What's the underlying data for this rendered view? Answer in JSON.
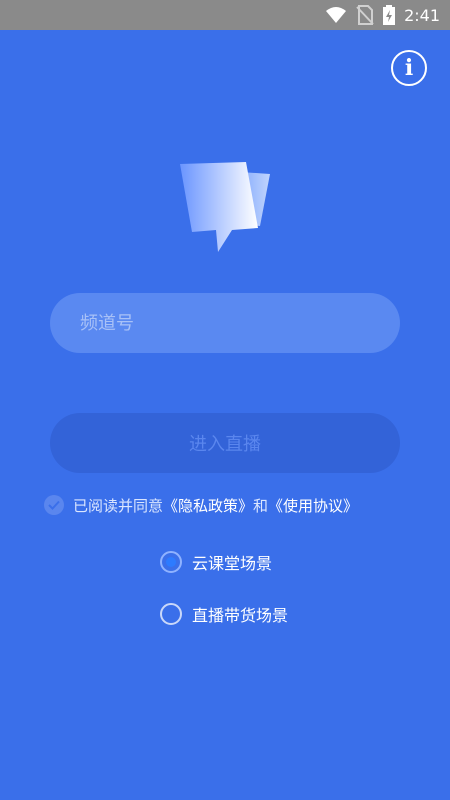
{
  "status_bar": {
    "time": "2:41",
    "icons": [
      "wifi-icon",
      "no-sim-icon",
      "battery-charging-icon"
    ]
  },
  "header": {
    "info_icon": "info-icon",
    "info_glyph": "i"
  },
  "logo": {
    "icon": "chat-bubble-logo-icon"
  },
  "form": {
    "channel_placeholder": "频道号",
    "channel_value": "",
    "enter_label": "进入直播"
  },
  "agreement": {
    "prefix": "已阅读并同意",
    "privacy_link": "《隐私政策》",
    "conjunction": "和",
    "terms_link": "《使用协议》",
    "checked": true
  },
  "scenes": {
    "options": [
      {
        "label": "云课堂场景",
        "selected": true
      },
      {
        "label": "直播带货场景",
        "selected": false
      }
    ]
  },
  "colors": {
    "background": "#3a6fea",
    "status_bar": "#8a8a8a",
    "radio_selected": "#2d7bff"
  }
}
